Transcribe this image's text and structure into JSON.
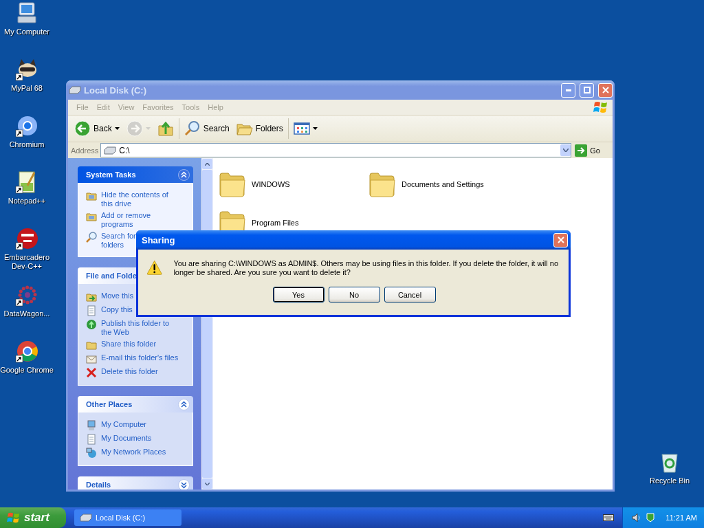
{
  "desktop_icons": [
    {
      "label": "My Computer",
      "kind": "computer",
      "shortcut": false
    },
    {
      "label": "MyPal 68",
      "kind": "raccoon",
      "shortcut": true
    },
    {
      "label": "Chromium",
      "kind": "ring",
      "shortcut": true
    },
    {
      "label": "Notepad++",
      "kind": "notepad",
      "shortcut": true
    },
    {
      "label": "Embarcadero Dev-C++",
      "kind": "dev",
      "shortcut": true
    },
    {
      "label": "DataWagon...",
      "kind": "dots",
      "shortcut": true
    },
    {
      "label": "Google Chrome",
      "kind": "chrome",
      "shortcut": true
    }
  ],
  "recycle_bin": {
    "label": "Recycle Bin"
  },
  "window": {
    "title": "Local Disk (C:)",
    "menu": [
      "File",
      "Edit",
      "View",
      "Favorites",
      "Tools",
      "Help"
    ],
    "toolbar": [
      {
        "kind": "back",
        "label": "Back",
        "disabled": false
      },
      {
        "kind": "forward",
        "disabled": true
      },
      {
        "kind": "up",
        "disabled": false
      },
      {
        "kind": "search",
        "label": "Search",
        "disabled": false
      },
      {
        "kind": "folders",
        "label": "Folders",
        "disabled": false
      },
      {
        "kind": "views",
        "disabled": false
      }
    ],
    "address": {
      "label": "Address",
      "value": "C:\\",
      "go": "Go"
    },
    "sidebar": [
      {
        "title": "System Tasks",
        "kind": "special",
        "expanded": true,
        "items": [
          {
            "label": "Hide the contents of this drive",
            "kind": "hide"
          },
          {
            "label": "Add or remove programs",
            "kind": "addremove"
          },
          {
            "label": "Search for\nfolders",
            "kind": "search"
          }
        ]
      },
      {
        "title": "File and Folde",
        "kind": "normal",
        "items": [
          {
            "label": "Move this",
            "kind": "move"
          },
          {
            "label": "Copy this",
            "kind": "copy"
          },
          {
            "label": "Publish this folder to the Web",
            "kind": "publish"
          },
          {
            "label": "Share this folder",
            "kind": "share"
          },
          {
            "label": "E-mail this folder's files",
            "kind": "email"
          },
          {
            "label": "Delete this folder",
            "kind": "delete"
          }
        ]
      },
      {
        "title": "Other Places",
        "kind": "normal",
        "expanded": true,
        "items": [
          {
            "label": "My Computer",
            "kind": "computer"
          },
          {
            "label": "My Documents",
            "kind": "documents"
          },
          {
            "label": "My Network Places",
            "kind": "network"
          }
        ]
      },
      {
        "title": "Details",
        "kind": "normal",
        "expanded": false
      }
    ],
    "files": [
      {
        "name": "WINDOWS"
      },
      {
        "name": "Documents and Settings"
      },
      {
        "name": "Program Files"
      }
    ]
  },
  "dialog": {
    "title": "Sharing",
    "message": "You are sharing C:\\WINDOWS as ADMIN$. Others may be using files in this folder. If you delete the folder, it will no longer be shared. Are you sure you want to delete it?",
    "buttons": [
      {
        "label": "Yes",
        "default": true
      },
      {
        "label": "No",
        "default": false
      },
      {
        "label": "Cancel",
        "default": false
      }
    ]
  },
  "taskbar": {
    "start": "start",
    "tasks": [
      {
        "label": "Local Disk (C:)"
      }
    ],
    "clock": "11:21 AM"
  }
}
